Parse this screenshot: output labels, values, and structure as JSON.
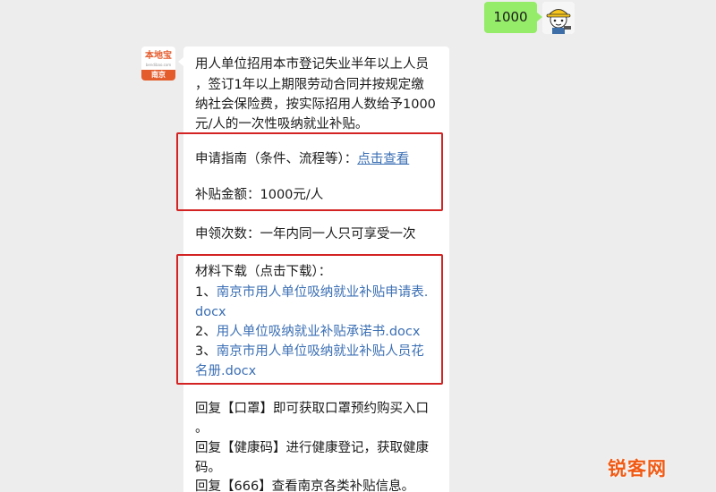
{
  "sent_message": {
    "text": "1000"
  },
  "bot_account": {
    "logo_text": "本地宝",
    "logo_sub": "bendibao.com",
    "city": "南京"
  },
  "reply": {
    "intro_lines": [
      "用人单位招用本市登记失业半年以上人员",
      "，签订1年以上期限劳动合同并按规定缴",
      "纳社会保险费，按实际招用人数给予1000",
      "元/人的一次性吸纳就业补贴。"
    ],
    "guide_label": "申请指南（条件、流程等）：",
    "guide_link": "点击查看",
    "amount": "补贴金额：1000元/人",
    "times": "申领次数：一年内同一人只可享受一次",
    "download_title": "材料下载（点击下载）：",
    "downloads": [
      {
        "num": "1、",
        "line1": "南京市用人单位吸纳就业补贴申请表.",
        "line2": "docx"
      },
      {
        "num": "2、",
        "line1": "用人单位吸纳就业补贴承诺书.docx"
      },
      {
        "num": "3、",
        "line1": "南京市用人单位吸纳就业补贴人员花",
        "line2": "名册.docx"
      }
    ],
    "footer_lines": [
      "回复【口罩】即可获取口罩预约购买入口",
      "。",
      "回复【健康码】进行健康登记，获取健康",
      "码。",
      "回复【666】查看南京各类补贴信息。"
    ]
  },
  "watermark": "锐客网",
  "colors": {
    "sent_bubble": "#95ec69",
    "link": "#3b6fb4",
    "highlight_box": "#d32323",
    "watermark": "#f05a14"
  }
}
